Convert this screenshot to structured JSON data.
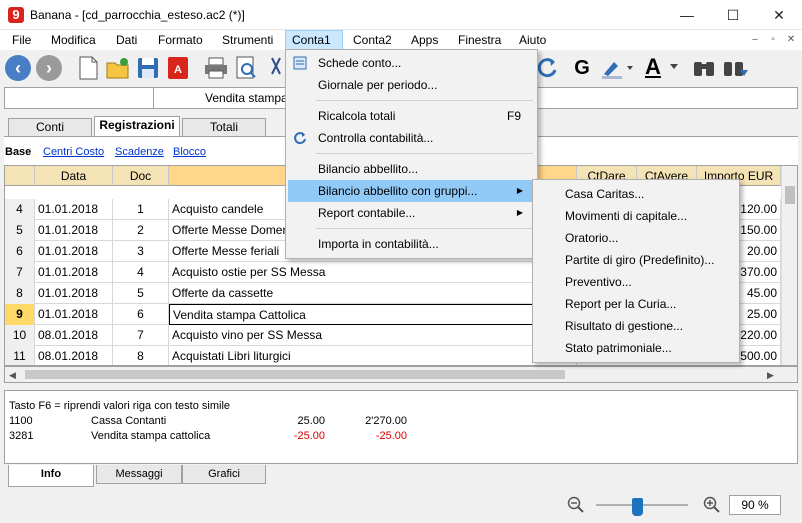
{
  "window": {
    "title": "Banana - [cd_parrocchia_esteso.ac2 (*)]",
    "logo_char": "9",
    "minimize": "—",
    "maximize": "☐",
    "close": "✕"
  },
  "menubar": {
    "items": [
      "File",
      "Modifica",
      "Dati",
      "Formato",
      "Strumenti",
      "Conta1",
      "Conta2",
      "Apps",
      "Finestra",
      "Aiuto"
    ],
    "mdi": [
      "–",
      "▫",
      "✕"
    ]
  },
  "toolbar": {
    "bold_label": "G",
    "font_color_label": "A"
  },
  "inputbar": {
    "value": "Vendita stampa Cattolica"
  },
  "tabs": [
    "Conti",
    "Registrazioni",
    "Totali"
  ],
  "views": [
    "Base",
    "Centri Costo",
    "Scadenze",
    "Blocco"
  ],
  "table": {
    "columns": [
      "Data",
      "Doc",
      "",
      "CtDare",
      "CtAvere",
      "Importo EUR"
    ],
    "rows": [
      {
        "num": "4",
        "date": "01.01.2018",
        "doc": "1",
        "desc": "Acquisto candele",
        "amount": "120.00"
      },
      {
        "num": "5",
        "date": "01.01.2018",
        "doc": "2",
        "desc": "Offerte Messe Domenicali",
        "amount": "150.00"
      },
      {
        "num": "6",
        "date": "01.01.2018",
        "doc": "3",
        "desc": "Offerte Messe feriali",
        "amount": "20.00"
      },
      {
        "num": "7",
        "date": "01.01.2018",
        "doc": "4",
        "desc": "Acquisto ostie per SS Messa",
        "amount": "370.00"
      },
      {
        "num": "8",
        "date": "01.01.2018",
        "doc": "5",
        "desc": "Offerte da cassette",
        "amount": "45.00"
      },
      {
        "num": "9",
        "date": "01.01.2018",
        "doc": "6",
        "desc": "Vendita stampa Cattolica",
        "amount": "25.00"
      },
      {
        "num": "10",
        "date": "08.01.2018",
        "doc": "7",
        "desc": "Acquisto vino per SS Messa",
        "amount": "220.00"
      },
      {
        "num": "11",
        "date": "08.01.2018",
        "doc": "8",
        "desc": "Acquistati Libri liturgici",
        "amount": "500.00"
      }
    ]
  },
  "info": {
    "hint": "Tasto F6 = riprendi valori riga con testo simile",
    "lines": [
      {
        "account": "1100",
        "name": "Cassa Contanti",
        "amount": "25.00",
        "balance": "2'270.00"
      },
      {
        "account": "3281",
        "name": "Vendita stampa cattolica",
        "amount": "-25.00",
        "balance": "-25.00"
      }
    ]
  },
  "bottom_tabs": [
    "Info",
    "Messaggi",
    "Grafici"
  ],
  "zoom": {
    "value": "90 %",
    "level_percent": 90
  },
  "conta1_menu": {
    "items": [
      {
        "label": "Schede conto...",
        "shortcut": "",
        "submenu": false
      },
      {
        "label": "Giornale per periodo...",
        "shortcut": "",
        "submenu": false
      },
      {
        "label": "Ricalcola totali",
        "shortcut": "F9",
        "submenu": false
      },
      {
        "label": "Controlla contabilità...",
        "shortcut": "",
        "submenu": false
      },
      {
        "label": "Bilancio abbellito...",
        "shortcut": "",
        "submenu": false
      },
      {
        "label": "Bilancio abbellito con gruppi...",
        "shortcut": "",
        "submenu": true
      },
      {
        "label": "Report contabile...",
        "shortcut": "",
        "submenu": true
      },
      {
        "label": "Importa in contabilità...",
        "shortcut": "",
        "submenu": false
      }
    ]
  },
  "submenu": {
    "items": [
      "Casa Caritas...",
      "Movimenti di capitale...",
      "Oratorio...",
      "Partite di giro (Predefinito)...",
      "Preventivo...",
      "Report per la Curia...",
      "Risultato di gestione...",
      "Stato patrimoniale..."
    ]
  },
  "colors": {
    "accent": "#4a7ec4",
    "header": "#f4e3b4",
    "menu_highlight": "#91c9f7",
    "negative": "#e00000",
    "selected_row_number": "#ffd966"
  }
}
